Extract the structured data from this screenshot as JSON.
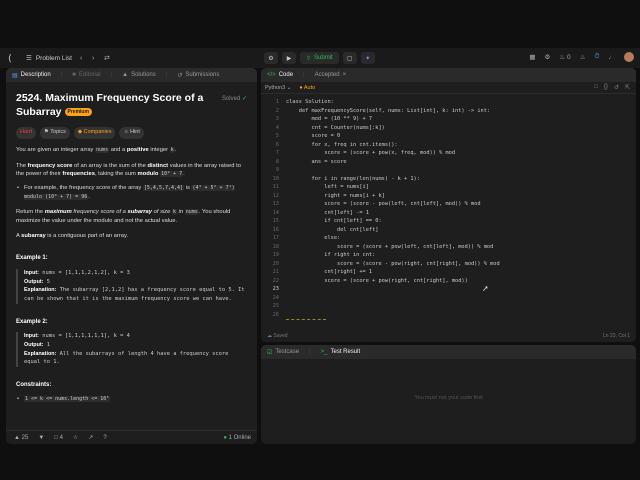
{
  "nav": {
    "problem_list": "Problem List",
    "submit": "Submit",
    "notif_count": "0"
  },
  "left_tabs": [
    "Description",
    "Editorial",
    "Solutions",
    "Submissions"
  ],
  "problem": {
    "title": "2524. Maximum Frequency Score of a Subarray",
    "premium": "Premium",
    "solved": "Solved",
    "tags": [
      "Hard",
      "Topics",
      "Companies",
      "Hint"
    ],
    "p1_a": "You are given an integer array ",
    "p1_code": "nums",
    "p1_b": " and a ",
    "p1_bold": "positive",
    "p1_c": " integer ",
    "p1_k": "k",
    "p1_d": ".",
    "p2_a": "The ",
    "p2_b1": "frequency score",
    "p2_c": " of an array is the sum of the ",
    "p2_b2": "distinct",
    "p2_d": " values in the array raised to the power of their ",
    "p2_b3": "frequencies",
    "p2_e": ", taking the sum ",
    "p2_b4": "modulo",
    "p2_code": "10⁹ + 7",
    "p2_f": ".",
    "bullet_a": "For example, the frequency score of the array ",
    "bullet_code1": "[5,4,5,7,4,4]",
    "bullet_b": " is ",
    "bullet_code2": "(4³ + 5² + 7¹) modulo (10⁹ + 7) = 96",
    "bullet_c": ".",
    "p3_a": "Return the ",
    "p3_b": "maximum",
    "p3_c": " frequency score of a ",
    "p3_d": "subarray",
    "p3_e": " of size ",
    "p3_k": "k",
    "p3_f": " in ",
    "p3_code": "nums",
    "p3_g": ". You should maximize the value under the modulo and not the actual value.",
    "p4_a": "A ",
    "p4_b": "subarray",
    "p4_c": " is a contiguous part of an array.",
    "ex1_title": "Example 1:",
    "ex1_input_label": "Input:",
    "ex1_input": " nums = [1,1,1,2,1,2], k = 3",
    "ex1_output_label": "Output:",
    "ex1_output": " 5",
    "ex1_expl_label": "Explanation:",
    "ex1_expl": " The subarray [2,1,2] has a frequency score equal to 5. It can be shown that it is the maximum frequency score we can have.",
    "ex2_title": "Example 2:",
    "ex2_input_label": "Input:",
    "ex2_input": " nums = [1,1,1,1,1,1], k = 4",
    "ex2_output_label": "Output:",
    "ex2_output": " 1",
    "ex2_expl_label": "Explanation:",
    "ex2_expl": " All the subarrays of length 4 have a frequency score equal to 1.",
    "constraints_title": "Constraints:",
    "constraint1": "1 <= k <= nums.length <= 10⁵"
  },
  "bottom": {
    "likes": "25",
    "comments": "4",
    "online": "1 Online"
  },
  "code_tabs": [
    "Code",
    "Accepted"
  ],
  "editor": {
    "language": "Python3",
    "auto": "Auto",
    "saved": "Saved",
    "position": "Ln 23, Col 1"
  },
  "code_lines": [
    "class Solution:",
    "    def maxFrequencyScore(self, nums: List[int], k: int) -> int:",
    "        mod = (10 ** 9) + 7",
    "        cnt = Counter(nums[:k])",
    "        score = 0",
    "        for x, freq in cnt.items():",
    "            score = (score + pow(x, freq, mod)) % mod",
    "        ans = score",
    "",
    "        for i in range(len(nums) - k + 1):",
    "            left = nums[i]",
    "            right = nums[i + k]",
    "            score = (score - pow(left, cnt[left], mod)) % mod",
    "            cnt[left] -= 1",
    "            if cnt[left] == 0:",
    "                del cnt[left]",
    "            else:",
    "                score = (score + pow(left, cnt[left], mod)) % mod",
    "            if right in cnt:",
    "                score = (score - pow(right, cnt[right], mod)) % mod",
    "            cnt[right] += 1",
    "            score = (score + pow(right, cnt[right], mod))",
    "",
    "",
    "",
    "",
    ""
  ],
  "line_numbers": [
    "1",
    "2",
    "3",
    "4",
    "5",
    "6",
    "7",
    "8",
    "9",
    "10",
    "11",
    "12",
    "13",
    "14",
    "15",
    "16",
    "17",
    "18",
    "19",
    "20",
    "21",
    "22",
    "23",
    "24",
    "25",
    "26",
    ""
  ],
  "test_tabs": [
    "Testcase",
    "Test Result"
  ],
  "test_empty": "You must run your code first"
}
